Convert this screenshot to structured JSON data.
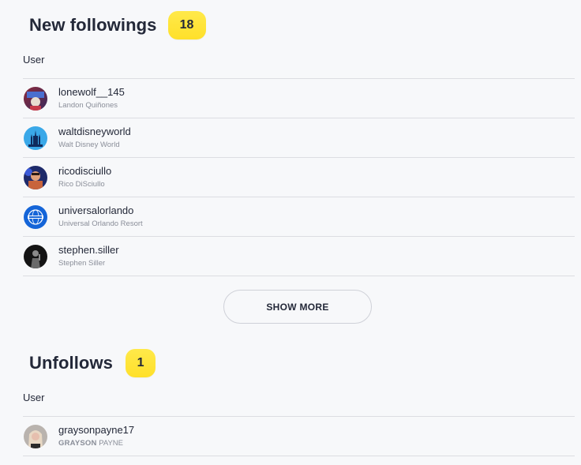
{
  "new_followings": {
    "title": "New followings",
    "count": "18",
    "column_header": "User",
    "users": [
      {
        "username": "lonewolf__145",
        "fullname": "Landon Quiñones",
        "avatar_icon": "avatar-photo-icon"
      },
      {
        "username": "waltdisneyworld",
        "fullname": "Walt Disney World",
        "avatar_icon": "castle-logo-icon"
      },
      {
        "username": "ricodisciullo",
        "fullname": "Rico DiSciullo",
        "avatar_icon": "avatar-photo-icon"
      },
      {
        "username": "universalorlando",
        "fullname": "Universal Orlando Resort",
        "avatar_icon": "globe-logo-icon"
      },
      {
        "username": "stephen.siller",
        "fullname": "Stephen Siller",
        "avatar_icon": "avatar-photo-icon"
      }
    ],
    "show_more_label": "SHOW MORE"
  },
  "unfollows": {
    "title": "Unfollows",
    "count": "1",
    "column_header": "User",
    "users": [
      {
        "username": "graysonpayne17",
        "fullname_bold": "GRAYSON",
        "fullname_rest": " PAYNE",
        "avatar_icon": "avatar-photo-icon"
      }
    ]
  },
  "colors": {
    "badge": "#ffe22e",
    "divider": "#dcdde2",
    "background": "#f7f8fa",
    "text": "#232838",
    "muted": "#8a8e99"
  }
}
